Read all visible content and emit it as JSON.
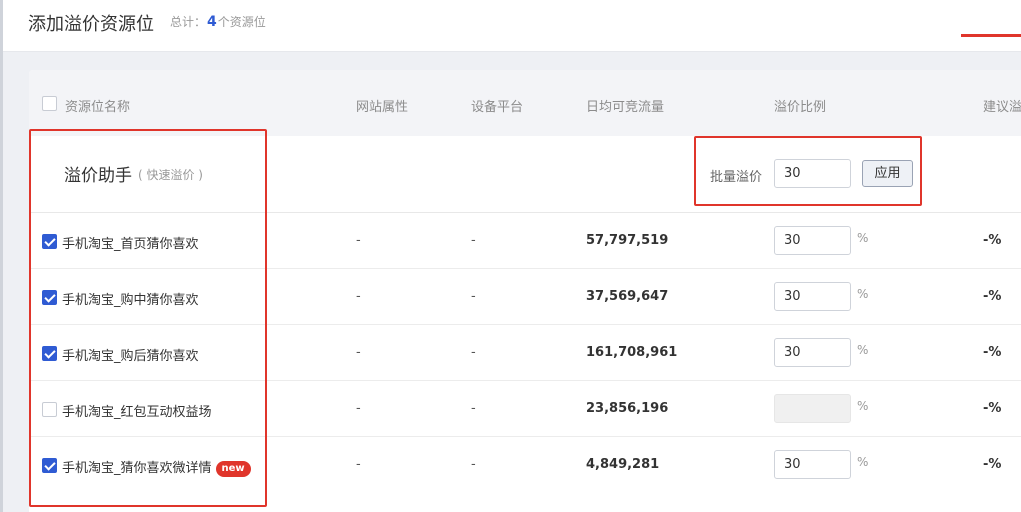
{
  "header": {
    "title": "添加溢价资源位",
    "summary_prefix": "总计：",
    "summary_count": "4",
    "summary_suffix": "个资源位"
  },
  "table": {
    "columns": [
      "资源位名称",
      "网站属性",
      "设备平台",
      "日均可竞流量",
      "溢价比例",
      "建议溢"
    ],
    "helper": {
      "title": "溢价助手",
      "subtitle": "( 快速溢价 )",
      "batch_label": "批量溢价",
      "batch_value": "30",
      "apply_label": "应用"
    },
    "rows": [
      {
        "name": "手机淘宝_首页猜你喜欢",
        "checked": true,
        "site": "-",
        "platform": "-",
        "traffic": "57,797,519",
        "rate": "30",
        "pct": "%",
        "suggest": "-%"
      },
      {
        "name": "手机淘宝_购中猜你喜欢",
        "checked": true,
        "site": "-",
        "platform": "-",
        "traffic": "37,569,647",
        "rate": "30",
        "pct": "%",
        "suggest": "-%"
      },
      {
        "name": "手机淘宝_购后猜你喜欢",
        "checked": true,
        "site": "-",
        "platform": "-",
        "traffic": "161,708,961",
        "rate": "30",
        "pct": "%",
        "suggest": "-%"
      },
      {
        "name": "手机淘宝_红包互动权益场",
        "checked": false,
        "site": "-",
        "platform": "-",
        "traffic": "23,856,196",
        "rate": "",
        "pct": "%",
        "suggest": "-%"
      },
      {
        "name": "手机淘宝_猜你喜欢微详情",
        "checked": true,
        "site": "-",
        "platform": "-",
        "traffic": "4,849,281",
        "rate": "30",
        "pct": "%",
        "suggest": "-%",
        "badge": "new"
      }
    ]
  },
  "colors": {
    "accent": "#2f5bd3",
    "highlight_red": "#e0352b"
  }
}
